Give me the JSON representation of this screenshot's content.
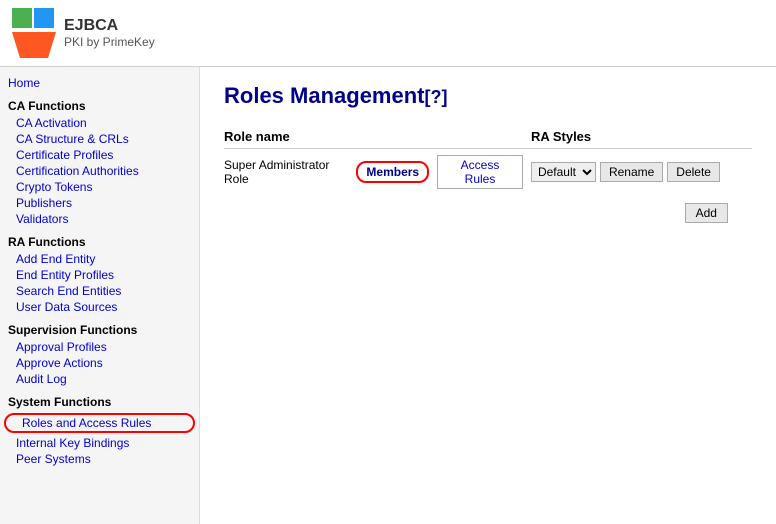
{
  "header": {
    "logo_ejbca": "EJBCA",
    "logo_pki": "PKI by PrimeKey"
  },
  "sidebar": {
    "home_label": "Home",
    "ca_functions_label": "CA Functions",
    "ca_links": [
      "CA Activation",
      "CA Structure & CRLs",
      "Certificate Profiles",
      "Certification Authorities",
      "Crypto Tokens",
      "Publishers",
      "Validators"
    ],
    "ra_functions_label": "RA Functions",
    "ra_links": [
      "Add End Entity",
      "End Entity Profiles",
      "Search End Entities",
      "User Data Sources"
    ],
    "supervision_functions_label": "Supervision Functions",
    "supervision_links": [
      "Approval Profiles",
      "Approve Actions",
      "Audit Log"
    ],
    "system_functions_label": "System Functions",
    "system_links_highlighted": "Roles and Access Rules",
    "system_links": [
      "Internal Key Bindings",
      "Peer Systems"
    ]
  },
  "main": {
    "page_title": "Roles Management",
    "page_title_help": "[?]",
    "table_headers": {
      "role_name": "Role name",
      "ra_styles": "RA Styles"
    },
    "roles": [
      {
        "name": "Super Administrator Role",
        "members_label": "Members",
        "access_rules_label": "Access Rules",
        "ra_style_default": "Default",
        "ra_style_options": [
          "Default"
        ],
        "rename_label": "Rename",
        "delete_label": "Delete"
      }
    ],
    "add_button_label": "Add"
  }
}
